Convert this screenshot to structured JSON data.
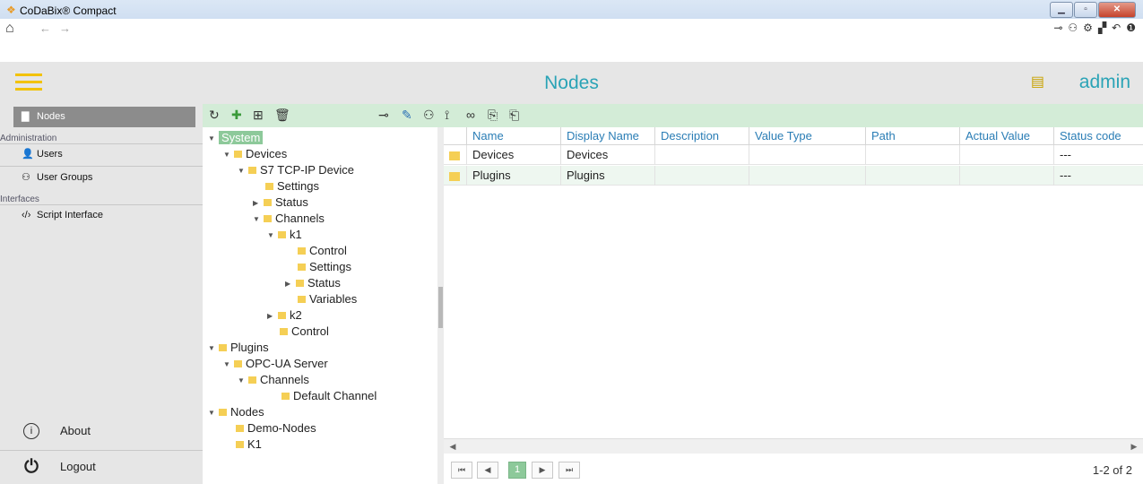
{
  "window": {
    "title": "CoDaBix® Compact"
  },
  "header": {
    "title": "Nodes",
    "user": "admin"
  },
  "sidebar": {
    "active": "Nodes",
    "section_admin": "Administration",
    "users": "Users",
    "user_groups": "User Groups",
    "section_interfaces": "Interfaces",
    "script_interface": "Script Interface",
    "about": "About",
    "logout": "Logout"
  },
  "tree": {
    "system": "System",
    "devices": "Devices",
    "s7": "S7 TCP-IP Device",
    "settings": "Settings",
    "status": "Status",
    "channels": "Channels",
    "k1": "k1",
    "k1_control": "Control",
    "k1_settings": "Settings",
    "k1_status": "Status",
    "k1_variables": "Variables",
    "k2": "k2",
    "control": "Control",
    "plugins": "Plugins",
    "opcua": "OPC-UA Server",
    "opc_channels": "Channels",
    "default_channel": "Default Channel",
    "nodes": "Nodes",
    "demo_nodes": "Demo-Nodes",
    "k1_root": "K1"
  },
  "grid": {
    "columns": [
      "Name",
      "Display Name",
      "Description",
      "Value Type",
      "Path",
      "Actual Value",
      "Status code"
    ],
    "rows": [
      {
        "name": "Devices",
        "display": "Devices",
        "status": "---"
      },
      {
        "name": "Plugins",
        "display": "Plugins",
        "status": "---"
      }
    ]
  },
  "pager": {
    "current": "1",
    "info": "1-2 of 2"
  },
  "colors": {
    "accent": "#2aa3b6",
    "toolbar": "#d3ecd7",
    "selected": "#8dc99a",
    "folder": "#f5cf55"
  }
}
